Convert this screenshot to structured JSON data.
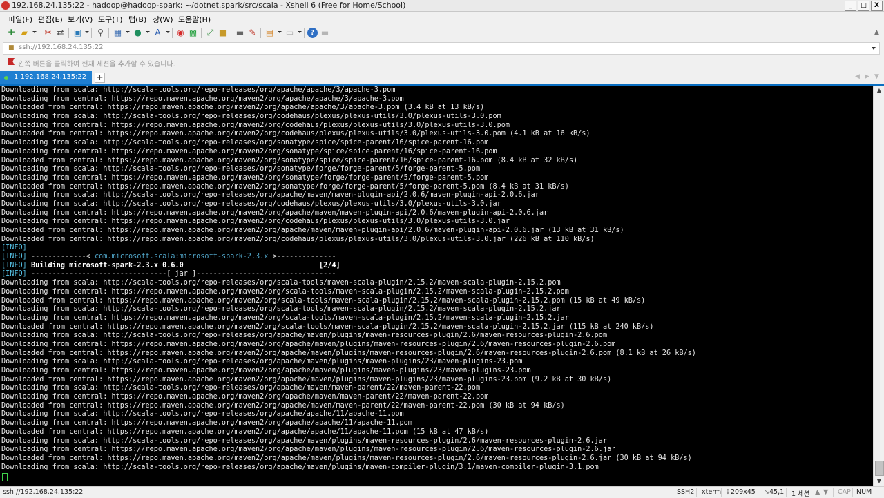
{
  "window": {
    "title": "192.168.24.135:22 - hadoop@hadoop-spark: ~/dotnet.spark/src/scala - Xshell 6 (Free for Home/School)",
    "minimize": "_",
    "maximize": "□",
    "close": "X"
  },
  "menu": [
    "파일(F)",
    "편집(E)",
    "보기(V)",
    "도구(T)",
    "탭(B)",
    "창(W)",
    "도움말(H)"
  ],
  "address": {
    "value": "ssh://192.168.24.135:22"
  },
  "hint": "왼쪽 버튼을 클릭하여 현재 세션을 추가할 수 있습니다.",
  "tabs": [
    {
      "label": "1 192.168.24.135:22"
    }
  ],
  "terminal": {
    "lines": [
      "Downloading from scala: http://scala-tools.org/repo-releases/org/apache/apache/3/apache-3.pom",
      "Downloading from central: https://repo.maven.apache.org/maven2/org/apache/apache/3/apache-3.pom",
      "Downloaded from central: https://repo.maven.apache.org/maven2/org/apache/apache/3/apache-3.pom (3.4 kB at 13 kB/s)",
      "Downloading from scala: http://scala-tools.org/repo-releases/org/codehaus/plexus/plexus-utils/3.0/plexus-utils-3.0.pom",
      "Downloading from central: https://repo.maven.apache.org/maven2/org/codehaus/plexus/plexus-utils/3.0/plexus-utils-3.0.pom",
      "Downloaded from central: https://repo.maven.apache.org/maven2/org/codehaus/plexus/plexus-utils/3.0/plexus-utils-3.0.pom (4.1 kB at 16 kB/s)",
      "Downloading from scala: http://scala-tools.org/repo-releases/org/sonatype/spice/spice-parent/16/spice-parent-16.pom",
      "Downloading from central: https://repo.maven.apache.org/maven2/org/sonatype/spice/spice-parent/16/spice-parent-16.pom",
      "Downloaded from central: https://repo.maven.apache.org/maven2/org/sonatype/spice/spice-parent/16/spice-parent-16.pom (8.4 kB at 32 kB/s)",
      "Downloading from scala: http://scala-tools.org/repo-releases/org/sonatype/forge/forge-parent/5/forge-parent-5.pom",
      "Downloading from central: https://repo.maven.apache.org/maven2/org/sonatype/forge/forge-parent/5/forge-parent-5.pom",
      "Downloaded from central: https://repo.maven.apache.org/maven2/org/sonatype/forge/forge-parent/5/forge-parent-5.pom (8.4 kB at 31 kB/s)",
      "Downloading from scala: http://scala-tools.org/repo-releases/org/apache/maven/maven-plugin-api/2.0.6/maven-plugin-api-2.0.6.jar",
      "Downloading from scala: http://scala-tools.org/repo-releases/org/codehaus/plexus/plexus-utils/3.0/plexus-utils-3.0.jar",
      "Downloading from central: https://repo.maven.apache.org/maven2/org/apache/maven/maven-plugin-api/2.0.6/maven-plugin-api-2.0.6.jar",
      "Downloading from central: https://repo.maven.apache.org/maven2/org/codehaus/plexus/plexus-utils/3.0/plexus-utils-3.0.jar",
      "Downloaded from central: https://repo.maven.apache.org/maven2/org/apache/maven/maven-plugin-api/2.0.6/maven-plugin-api-2.0.6.jar (13 kB at 31 kB/s)",
      "Downloaded from central: https://repo.maven.apache.org/maven2/org/codehaus/plexus/plexus-utils/3.0/plexus-utils-3.0.jar (226 kB at 110 kB/s)",
      "[INFO]",
      "[INFO] -------------< com.microsoft.scala:microsoft-spark-2.3.x >--------------",
      "[INFO] Building microsoft-spark-2.3.x 0.6.0                                [2/4]",
      "[INFO] --------------------------------[ jar ]---------------------------------",
      "Downloading from scala: http://scala-tools.org/repo-releases/org/scala-tools/maven-scala-plugin/2.15.2/maven-scala-plugin-2.15.2.pom",
      "Downloading from central: https://repo.maven.apache.org/maven2/org/scala-tools/maven-scala-plugin/2.15.2/maven-scala-plugin-2.15.2.pom",
      "Downloaded from central: https://repo.maven.apache.org/maven2/org/scala-tools/maven-scala-plugin/2.15.2/maven-scala-plugin-2.15.2.pom (15 kB at 49 kB/s)",
      "Downloading from scala: http://scala-tools.org/repo-releases/org/scala-tools/maven-scala-plugin/2.15.2/maven-scala-plugin-2.15.2.jar",
      "Downloading from central: https://repo.maven.apache.org/maven2/org/scala-tools/maven-scala-plugin/2.15.2/maven-scala-plugin-2.15.2.jar",
      "Downloaded from central: https://repo.maven.apache.org/maven2/org/scala-tools/maven-scala-plugin/2.15.2/maven-scala-plugin-2.15.2.jar (115 kB at 240 kB/s)",
      "Downloading from scala: http://scala-tools.org/repo-releases/org/apache/maven/plugins/maven-resources-plugin/2.6/maven-resources-plugin-2.6.pom",
      "Downloading from central: https://repo.maven.apache.org/maven2/org/apache/maven/plugins/maven-resources-plugin/2.6/maven-resources-plugin-2.6.pom",
      "Downloaded from central: https://repo.maven.apache.org/maven2/org/apache/maven/plugins/maven-resources-plugin/2.6/maven-resources-plugin-2.6.pom (8.1 kB at 26 kB/s)",
      "Downloading from scala: http://scala-tools.org/repo-releases/org/apache/maven/plugins/maven-plugins/23/maven-plugins-23.pom",
      "Downloading from central: https://repo.maven.apache.org/maven2/org/apache/maven/plugins/maven-plugins/23/maven-plugins-23.pom",
      "Downloaded from central: https://repo.maven.apache.org/maven2/org/apache/maven/plugins/maven-plugins/23/maven-plugins-23.pom (9.2 kB at 30 kB/s)",
      "Downloading from scala: http://scala-tools.org/repo-releases/org/apache/maven/maven-parent/22/maven-parent-22.pom",
      "Downloading from central: https://repo.maven.apache.org/maven2/org/apache/maven/maven-parent/22/maven-parent-22.pom",
      "Downloaded from central: https://repo.maven.apache.org/maven2/org/apache/maven/maven-parent/22/maven-parent-22.pom (30 kB at 94 kB/s)",
      "Downloading from scala: http://scala-tools.org/repo-releases/org/apache/apache/11/apache-11.pom",
      "Downloading from central: https://repo.maven.apache.org/maven2/org/apache/apache/11/apache-11.pom",
      "Downloaded from central: https://repo.maven.apache.org/maven2/org/apache/apache/11/apache-11.pom (15 kB at 47 kB/s)",
      "Downloading from scala: http://scala-tools.org/repo-releases/org/apache/maven/plugins/maven-resources-plugin/2.6/maven-resources-plugin-2.6.jar",
      "Downloading from central: https://repo.maven.apache.org/maven2/org/apache/maven/plugins/maven-resources-plugin/2.6/maven-resources-plugin-2.6.jar",
      "Downloaded from central: https://repo.maven.apache.org/maven2/org/apache/maven/plugins/maven-resources-plugin/2.6/maven-resources-plugin-2.6.jar (30 kB at 94 kB/s)",
      "Downloading from scala: http://scala-tools.org/repo-releases/org/apache/maven/plugins/maven-compiler-plugin/3.1/maven-compiler-plugin-3.1.pom"
    ]
  },
  "status": {
    "session": "ssh://192.168.24.135:22",
    "protocol": "SSH2",
    "term": "xterm",
    "size": "209x45",
    "cursor": "45,1",
    "sessions": "1 세션",
    "cap": "CAP",
    "num": "NUM"
  },
  "colors": {
    "tab_active": "#1f7fd1",
    "terminal_bg": "#000000",
    "terminal_fg": "#e6e6e6",
    "info_tag": "#55c1e6",
    "cursor": "#3fd14a"
  },
  "icons": [
    "new-session-icon",
    "open-folder-icon",
    "disconnect-icon",
    "reconnect-icon",
    "new-window-icon",
    "find-icon",
    "properties-icon",
    "globe-icon",
    "font-icon",
    "record-icon",
    "xftp-icon",
    "fullscreen-icon",
    "lock-icon",
    "keyboard-icon",
    "highlight-icon",
    "script-icon",
    "layout-icon",
    "help-icon",
    "chat-icon"
  ]
}
